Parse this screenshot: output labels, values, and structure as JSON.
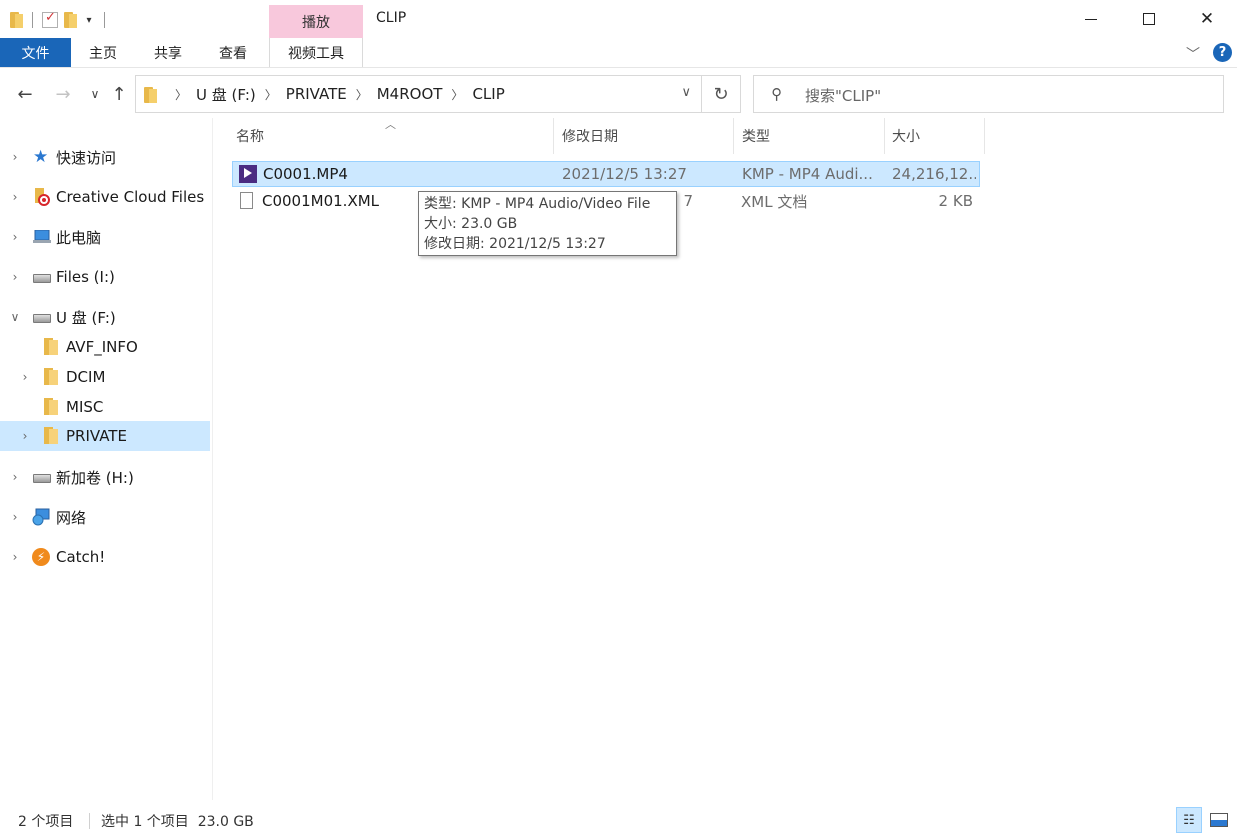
{
  "window": {
    "title": "CLIP",
    "context_tab_group": "播放"
  },
  "ribbon": {
    "tabs": [
      "文件",
      "主页",
      "共享",
      "查看",
      "视频工具"
    ]
  },
  "address": {
    "crumbs": [
      "U 盘 (F:)",
      "PRIVATE",
      "M4ROOT",
      "CLIP"
    ]
  },
  "search": {
    "placeholder": "搜索\"CLIP\""
  },
  "nav_tree": [
    {
      "label": "快速访问",
      "icon": "star-icon",
      "expander": "collapsed"
    },
    {
      "label": "Creative Cloud Files",
      "icon": "creative-cloud-icon",
      "expander": "collapsed"
    },
    {
      "label": "此电脑",
      "icon": "computer-icon",
      "expander": "collapsed"
    },
    {
      "label": "Files (I:)",
      "icon": "drive-icon",
      "expander": "collapsed"
    },
    {
      "label": "U 盘 (F:)",
      "icon": "drive-icon",
      "expander": "expanded"
    },
    {
      "label": "AVF_INFO",
      "icon": "folder-icon",
      "expander": "none"
    },
    {
      "label": "DCIM",
      "icon": "folder-icon",
      "expander": "collapsed"
    },
    {
      "label": "MISC",
      "icon": "folder-icon",
      "expander": "none"
    },
    {
      "label": "PRIVATE",
      "icon": "folder-icon",
      "expander": "collapsed",
      "selected": true
    },
    {
      "label": "新加卷 (H:)",
      "icon": "drive-icon",
      "expander": "collapsed"
    },
    {
      "label": "网络",
      "icon": "network-icon",
      "expander": "collapsed"
    },
    {
      "label": "Catch!",
      "icon": "catch-icon",
      "expander": "collapsed"
    }
  ],
  "columns": {
    "name": "名称",
    "modified": "修改日期",
    "type": "类型",
    "size": "大小"
  },
  "files": [
    {
      "name": "C0001.MP4",
      "modified": "2021/12/5 13:27",
      "type": "KMP - MP4 Audi...",
      "size": "24,216,12...",
      "icon": "kmp-video-icon",
      "selected": true
    },
    {
      "name": "C0001M01.XML",
      "modified": "7",
      "type": "XML 文档",
      "size": "2 KB",
      "icon": "document-icon",
      "selected": false
    }
  ],
  "tooltip": {
    "type_line": "类型: KMP - MP4 Audio/Video File",
    "size_line": "大小: 23.0 GB",
    "date_line": "修改日期: 2021/12/5 13:27"
  },
  "status": {
    "item_count": "2 个项目",
    "selection": "选中 1 个项目  23.0 GB"
  },
  "colors": {
    "file_tab": "#1a66b8",
    "context_tab": "#f8c8dc",
    "selection": "#cce8ff"
  }
}
